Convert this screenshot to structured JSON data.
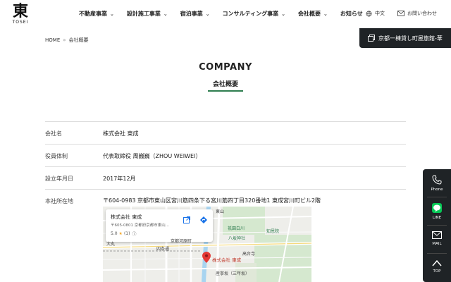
{
  "brand": {
    "mark": "東",
    "name": "TOSEI"
  },
  "nav": {
    "items": [
      {
        "label": "不動産事業",
        "has_dropdown": true
      },
      {
        "label": "設計施工事業",
        "has_dropdown": true
      },
      {
        "label": "宿泊事業",
        "has_dropdown": true
      },
      {
        "label": "コンサルティング事業",
        "has_dropdown": true
      },
      {
        "label": "会社概要",
        "has_dropdown": true
      },
      {
        "label": "お知らせ",
        "has_dropdown": false
      }
    ],
    "language_label": "中文",
    "contact_label": "お問い合わせ"
  },
  "booking_tab": {
    "label": "京都一棟貸し町屋旅館-華"
  },
  "breadcrumb": {
    "home": "HOME",
    "separator": "»",
    "current": "会社概要"
  },
  "page": {
    "title": "COMPANY",
    "subtitle": "会社概要"
  },
  "company_info": {
    "rows": [
      {
        "label": "会社名",
        "value": "株式会社 東成"
      },
      {
        "label": "役員体制",
        "value": "代表取締役 周巍巍（ZHOU WEIWEI）"
      },
      {
        "label": "設立年月日",
        "value": "2017年12月"
      },
      {
        "label": "本社所在地",
        "value": "〒604-0983 京都市東山区宮川筋四条下る宮川筋四丁目320番地1 東成宮川町ビル2階"
      }
    ]
  },
  "map": {
    "card": {
      "name": "株式会社 東成",
      "address": "〒605-0801 京都府京都市東山...",
      "rating": "5.0",
      "review_count": "(1)"
    },
    "labels": {
      "gion_shirakawa": "祇園白川",
      "yasaka": "八坂神社",
      "chionin": "知恩院",
      "kodaiji": "高台寺",
      "sannenzaka": "産寧坂（三年坂）",
      "shijo": "四条通",
      "kawaramachi": "京都河原町",
      "pin": "株式会社 東成",
      "higashiyama": "東山",
      "daimaru": "大丸"
    },
    "colors": {
      "pin": "#e53935",
      "park": "#cfe7c9",
      "water": "#a8d4f0",
      "road": "#ffffff"
    }
  },
  "side_actions": {
    "phone": "Phone",
    "line": "LINE",
    "mail": "MAIL",
    "top": "TOP"
  },
  "colors": {
    "accent_green": "#2e7d4f",
    "dark_bar": "#1f2326"
  }
}
